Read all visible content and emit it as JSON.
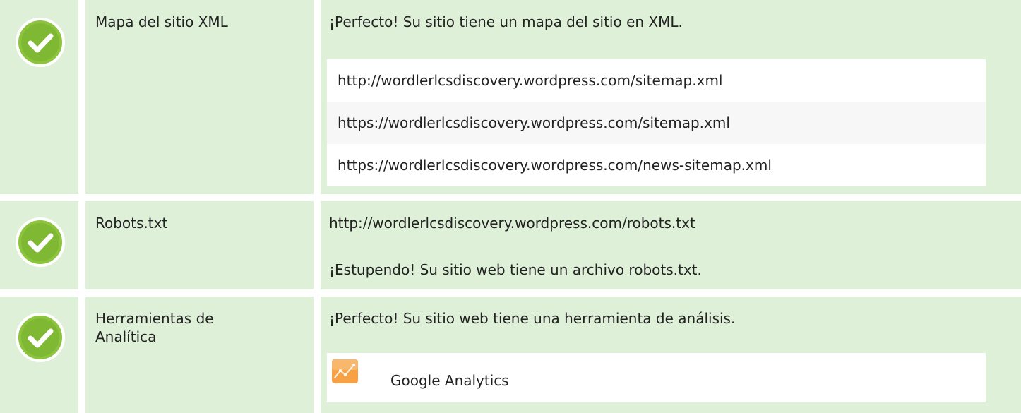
{
  "rows": [
    {
      "label": "Mapa del sitio XML",
      "status": "passed",
      "message": "¡Perfecto! Su sitio tiene un mapa del sitio en XML.",
      "sitemaps": [
        "http://wordlerlcsdiscovery.wordpress.com/sitemap.xml",
        "https://wordlerlcsdiscovery.wordpress.com/sitemap.xml",
        "https://wordlerlcsdiscovery.wordpress.com/news-sitemap.xml"
      ]
    },
    {
      "label": "Robots.txt",
      "status": "passed",
      "url": "http://wordlerlcsdiscovery.wordpress.com/robots.txt",
      "message": "¡Estupendo! Su sitio web tiene un archivo robots.txt."
    },
    {
      "label_line1": "Herramientas de",
      "label_line2": "Analítica",
      "status": "passed",
      "message": "¡Perfecto! Su sitio web tiene una herramienta de análisis.",
      "tool": {
        "name": "Google Analytics",
        "icon": "google-analytics-icon"
      }
    }
  ],
  "colors": {
    "row_bg": "#dff0d8",
    "check_fill": "#8cc43e",
    "check_ring": "#ffffff",
    "ga_orange": "#f7a144"
  }
}
